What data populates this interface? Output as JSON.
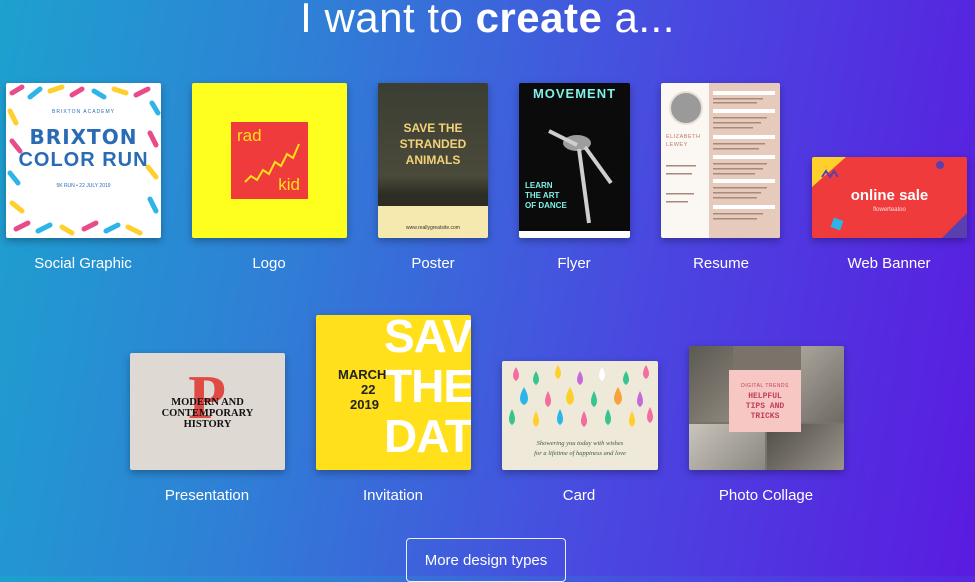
{
  "header": {
    "prefix": "I want to",
    "bold": "create",
    "suffix": "a..."
  },
  "tiles": [
    {
      "label": "Social Graphic",
      "art": {
        "line1": "BRIXTON",
        "line2": "COLOR RUN",
        "small": "BRIXTON ACADEMY",
        "date": "5K RUN • 22 JULY 2019"
      }
    },
    {
      "label": "Logo",
      "art": {
        "line1": "rad",
        "line2": "kid"
      }
    },
    {
      "label": "Poster",
      "art": {
        "line1": "SAVE THE",
        "line2": "STRANDED",
        "line3": "ANIMALS",
        "footer": "www.reallygreatsite.com"
      }
    },
    {
      "label": "Flyer",
      "art": {
        "title": "MOVEMENT",
        "line1": "LEARN",
        "line2": "THE ART",
        "line3": "OF DANCE"
      }
    },
    {
      "label": "Resume",
      "art": {
        "name1": "ELIZABETH",
        "name2": "LEWEY"
      }
    },
    {
      "label": "Web Banner",
      "art": {
        "title": "online sale",
        "sub": "flowerteatoo"
      }
    },
    {
      "label": "Presentation",
      "art": {
        "letter": "P",
        "line1": "MODERN AND",
        "line2": "CONTEMPORARY",
        "line3": "HISTORY"
      }
    },
    {
      "label": "Invitation",
      "art": {
        "big1": "SAVE",
        "big2": "THE",
        "big3": "DATE",
        "month": "MARCH",
        "day": "22",
        "year": "2019"
      }
    },
    {
      "label": "Card",
      "art": {
        "text1": "Showering you today with wishes",
        "text2": "for a lifetime of happiness and love"
      }
    },
    {
      "label": "Photo Collage",
      "art": {
        "top": "DIGITAL TRENDS",
        "line1": "HELPFUL",
        "line2": "TIPS AND",
        "line3": "TRICKS"
      }
    }
  ],
  "more_button": {
    "label": "More design types"
  },
  "colors": {
    "accent_yellow": "#ffe01a",
    "accent_red": "#ef3b3b",
    "card_bg": "#efe9d9"
  }
}
